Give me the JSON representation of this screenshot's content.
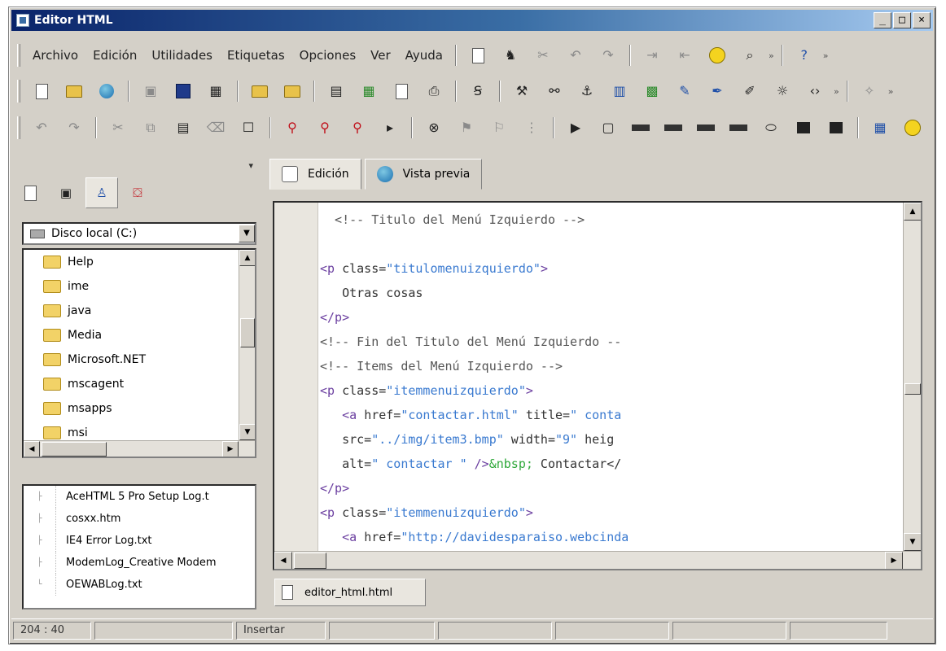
{
  "window": {
    "title": "Editor HTML",
    "controls": {
      "minimize": "_",
      "maximize": "□",
      "close": "×"
    }
  },
  "menu": {
    "items": [
      "Archivo",
      "Edición",
      "Utilidades",
      "Etiquetas",
      "Opciones",
      "Ver",
      "Ayuda"
    ]
  },
  "left_panel": {
    "drive": "Disco local (C:)",
    "folders": [
      "Help",
      "ime",
      "java",
      "Media",
      "Microsoft.NET",
      "mscagent",
      "msapps",
      "msi"
    ],
    "files": [
      "AceHTML 5 Pro Setup Log.t",
      "cosxx.htm",
      "IE4 Error Log.txt",
      "ModemLog_Creative Modem",
      "OEWABLog.txt"
    ]
  },
  "editor": {
    "tabs": [
      {
        "label": "Edición",
        "active": true
      },
      {
        "label": "Vista previa",
        "active": false
      }
    ],
    "document_tab": "editor_html.html",
    "code_lines": [
      [
        [
          "t-com",
          "  <!-- Titulo del Menú Izquierdo -->"
        ]
      ],
      [
        [
          "t-txt",
          ""
        ]
      ],
      [
        [
          "t-tag",
          "<p "
        ],
        [
          "t-attr",
          "class="
        ],
        [
          "t-str",
          "\"titulomenuizquierdo\""
        ],
        [
          "t-tag",
          ">"
        ]
      ],
      [
        [
          "t-txt",
          "   Otras cosas"
        ]
      ],
      [
        [
          "t-tag",
          "</p>"
        ]
      ],
      [
        [
          "t-com",
          "<!-- Fin del Titulo del Menú Izquierdo --"
        ]
      ],
      [
        [
          "t-com",
          "<!-- Items del Menú Izquierdo -->"
        ]
      ],
      [
        [
          "t-tag",
          "<p "
        ],
        [
          "t-attr",
          "class="
        ],
        [
          "t-str",
          "\"itemmenuizquierdo\""
        ],
        [
          "t-tag",
          ">"
        ]
      ],
      [
        [
          "t-tag",
          "   <a "
        ],
        [
          "t-attr",
          "href="
        ],
        [
          "t-str",
          "\"contactar.html\""
        ],
        [
          "t-attr",
          " title="
        ],
        [
          "t-str",
          "\" conta"
        ]
      ],
      [
        [
          "t-attr",
          "   src="
        ],
        [
          "t-str",
          "\"../img/item3.bmp\""
        ],
        [
          "t-attr",
          " width="
        ],
        [
          "t-str",
          "\"9\""
        ],
        [
          "t-attr",
          " heig"
        ]
      ],
      [
        [
          "t-attr",
          "   alt="
        ],
        [
          "t-str",
          "\" contactar \""
        ],
        [
          "t-tag",
          " />"
        ],
        [
          "t-grn",
          "&nbsp;"
        ],
        [
          "t-txt",
          " Contactar</"
        ]
      ],
      [
        [
          "t-tag",
          "</p>"
        ]
      ],
      [
        [
          "t-tag",
          "<p "
        ],
        [
          "t-attr",
          "class="
        ],
        [
          "t-str",
          "\"itemmenuizquierdo\""
        ],
        [
          "t-tag",
          ">"
        ]
      ],
      [
        [
          "t-tag",
          "   <a "
        ],
        [
          "t-attr",
          "href="
        ],
        [
          "t-str",
          "\"http://davidesparaiso.webcinda"
        ]
      ]
    ]
  },
  "status": {
    "position": "204 : 40",
    "mode": "Insertar"
  },
  "colors": {
    "titlebar_start": "#0a246a",
    "titlebar_end": "#a6caf0",
    "chrome": "#d4d0c8",
    "tag": "#6b3fa0",
    "string": "#3a7ad0",
    "entity": "#2fa83a"
  }
}
